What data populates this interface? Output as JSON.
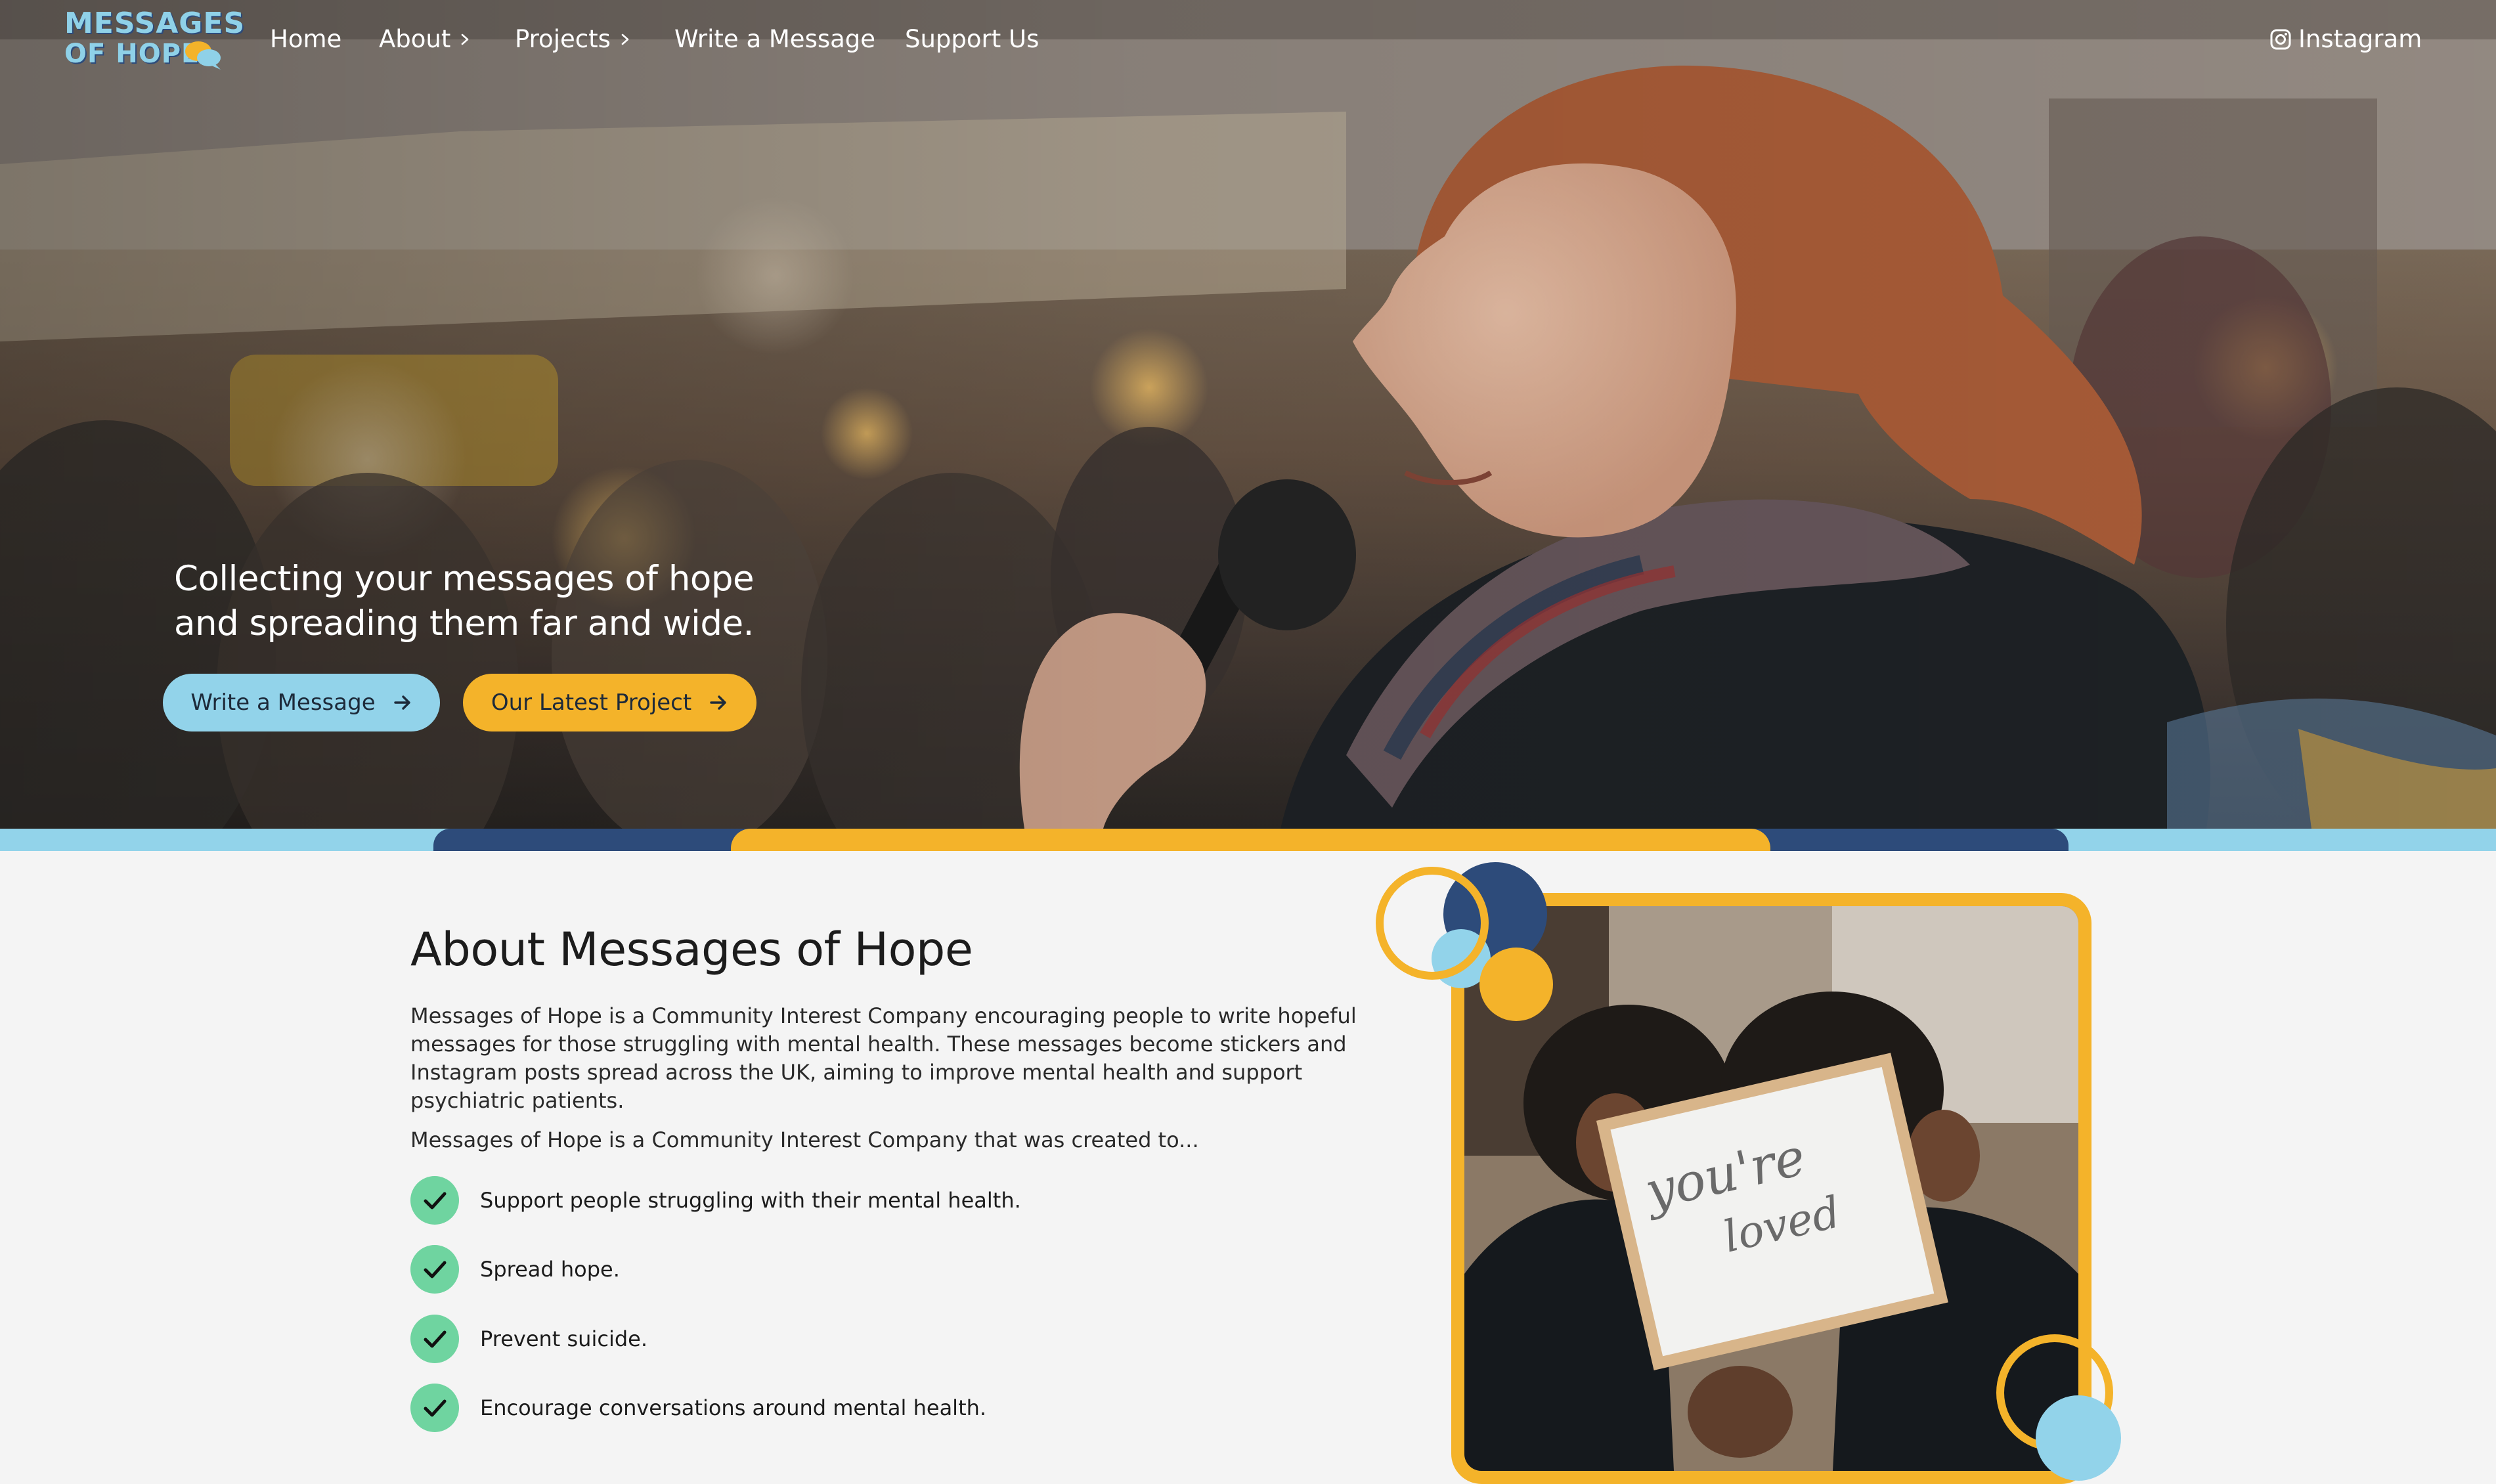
{
  "brand": {
    "logo_line1": "MESSAGES",
    "logo_line2": "OF HOPE",
    "colors": {
      "yellow": "#f4b32a",
      "light_blue": "#92d3ea",
      "navy": "#2d4b7a",
      "green": "#6fd4a0"
    }
  },
  "nav": {
    "items": [
      {
        "label": "Home",
        "has_chevron": false
      },
      {
        "label": "About",
        "has_chevron": true
      },
      {
        "label": "Projects",
        "has_chevron": true
      },
      {
        "label": "Write a Message",
        "has_chevron": false
      },
      {
        "label": "Support Us",
        "has_chevron": false
      }
    ],
    "instagram": {
      "label": "Instagram",
      "icon": "instagram-icon"
    }
  },
  "hero": {
    "title_line1": "Collecting your messages of hope",
    "title_line2": "and spreading them far and wide.",
    "buttons": [
      {
        "label": "Write a Message",
        "icon": "arrow-right-icon"
      },
      {
        "label": "Our Latest Project",
        "icon": "arrow-right-icon"
      }
    ]
  },
  "about": {
    "title": "About Messages of Hope",
    "paragraph1": "Messages of Hope is a Community Interest Company encouraging people to write hopeful messages for those struggling with mental health. These messages become stickers and Instagram posts spread across the UK, aiming to improve mental health and support psychiatric patients.",
    "paragraph2": "Messages of Hope is a Community Interest Company that was created to...",
    "checklist": [
      "Support people struggling with their mental health.",
      "Spread hope.",
      "Prevent suicide.",
      "Encourage conversations around mental health."
    ]
  },
  "photo": {
    "sign_line1": "you're",
    "sign_line2": "loved"
  }
}
